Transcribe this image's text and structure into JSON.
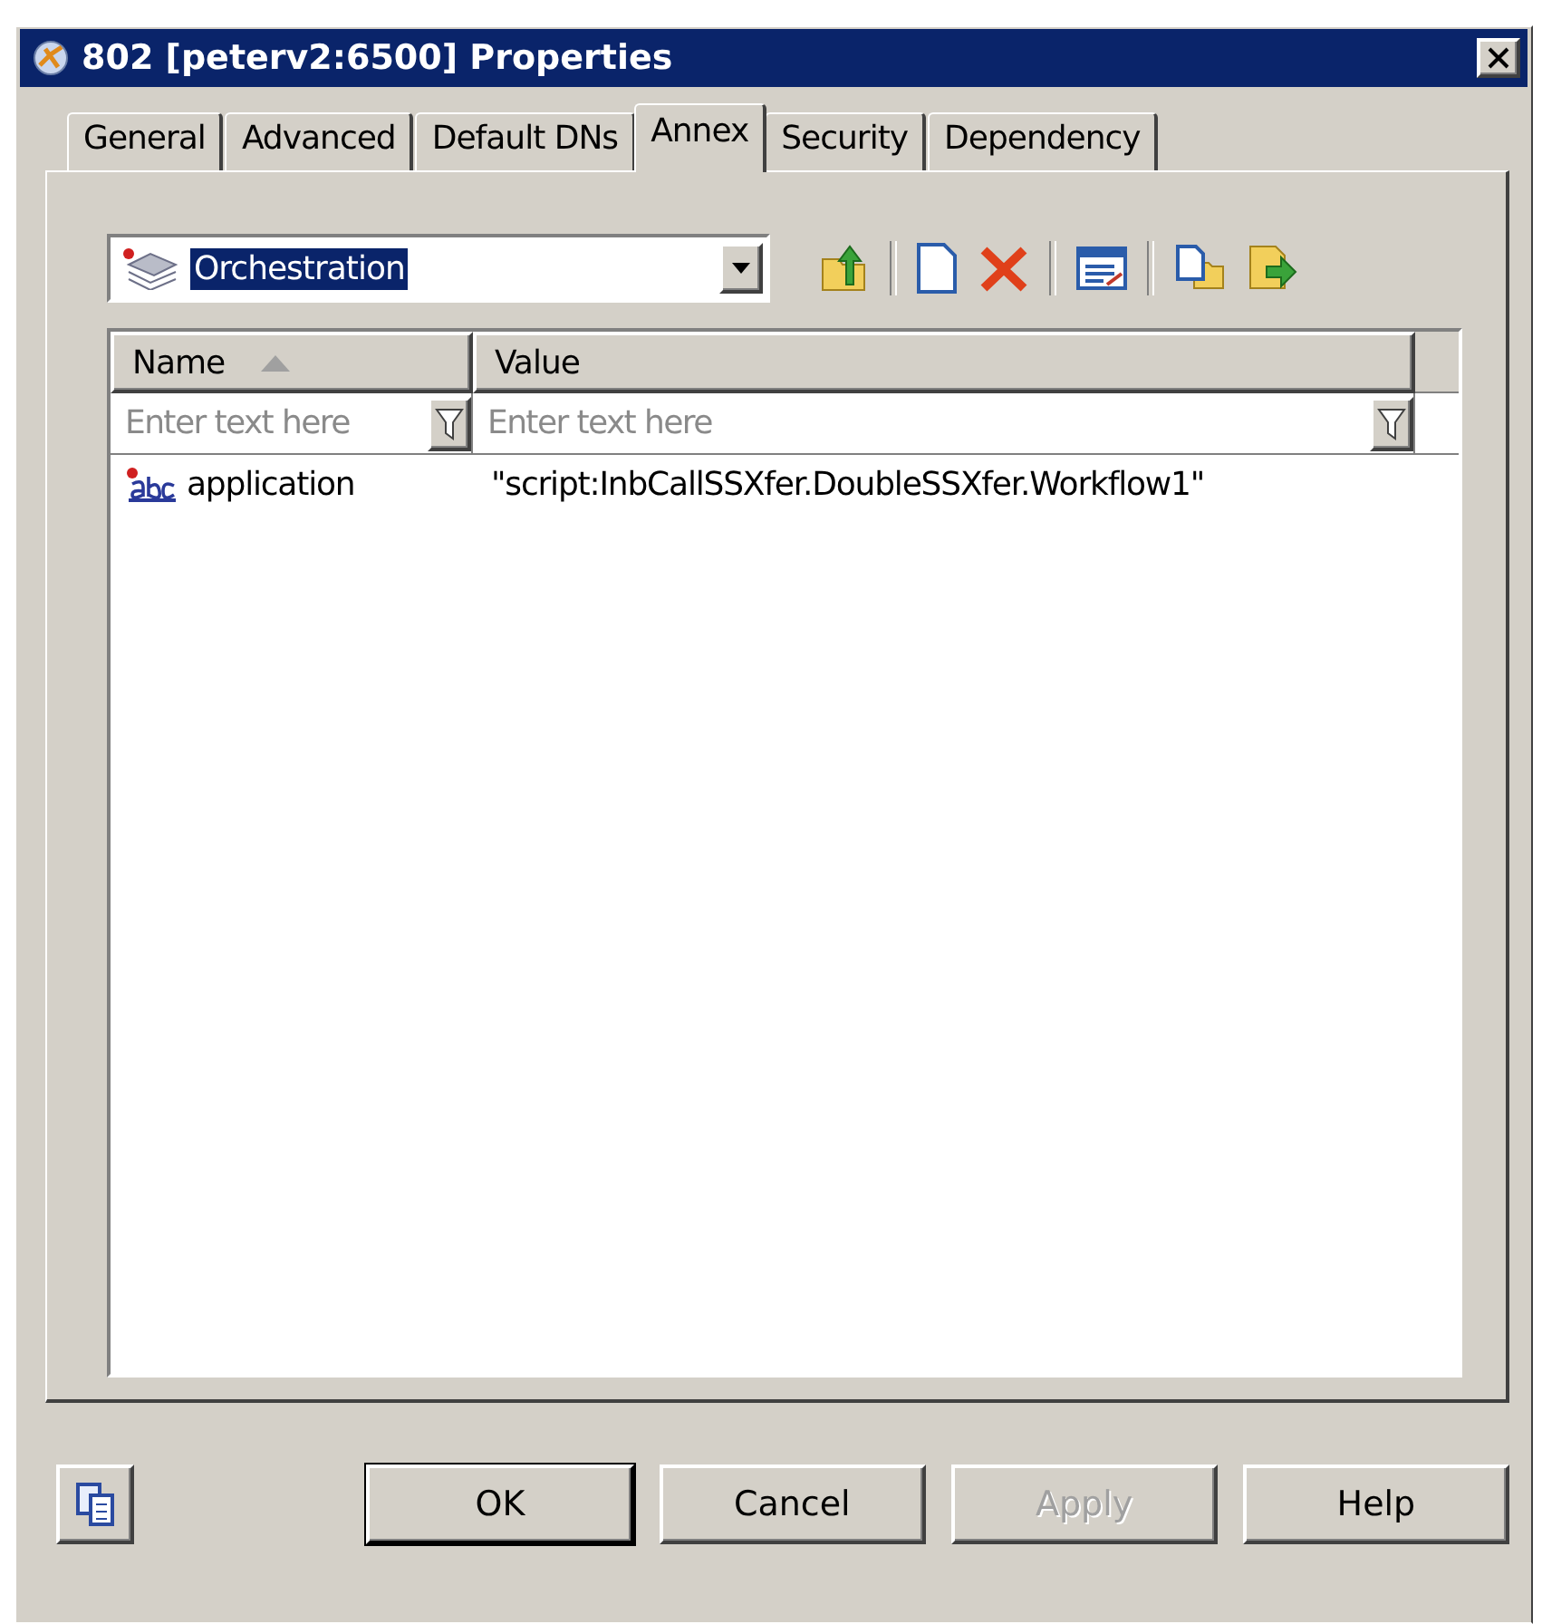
{
  "window": {
    "title": "802 [peterv2:6500] Properties"
  },
  "tabs": [
    {
      "label": "General",
      "selected": false
    },
    {
      "label": "Advanced",
      "selected": false
    },
    {
      "label": "Default DNs",
      "selected": false
    },
    {
      "label": "Annex",
      "selected": true
    },
    {
      "label": "Security",
      "selected": false
    },
    {
      "label": "Dependency",
      "selected": false
    }
  ],
  "section_dropdown": {
    "value": "Orchestration"
  },
  "table": {
    "columns": [
      {
        "label": "Name",
        "sorted": true,
        "placeholder": "Enter text here"
      },
      {
        "label": "Value",
        "sorted": false,
        "placeholder": "Enter text here"
      }
    ],
    "rows": [
      {
        "name": "application",
        "value": "\"script:InbCallSSXfer.DoubleSSXfer.Workflow1\""
      }
    ]
  },
  "buttons": [
    {
      "label": "OK",
      "default": true,
      "disabled": false
    },
    {
      "label": "Cancel",
      "default": false,
      "disabled": false
    },
    {
      "label": "Apply",
      "default": false,
      "disabled": true
    },
    {
      "label": "Help",
      "default": false,
      "disabled": false
    }
  ]
}
